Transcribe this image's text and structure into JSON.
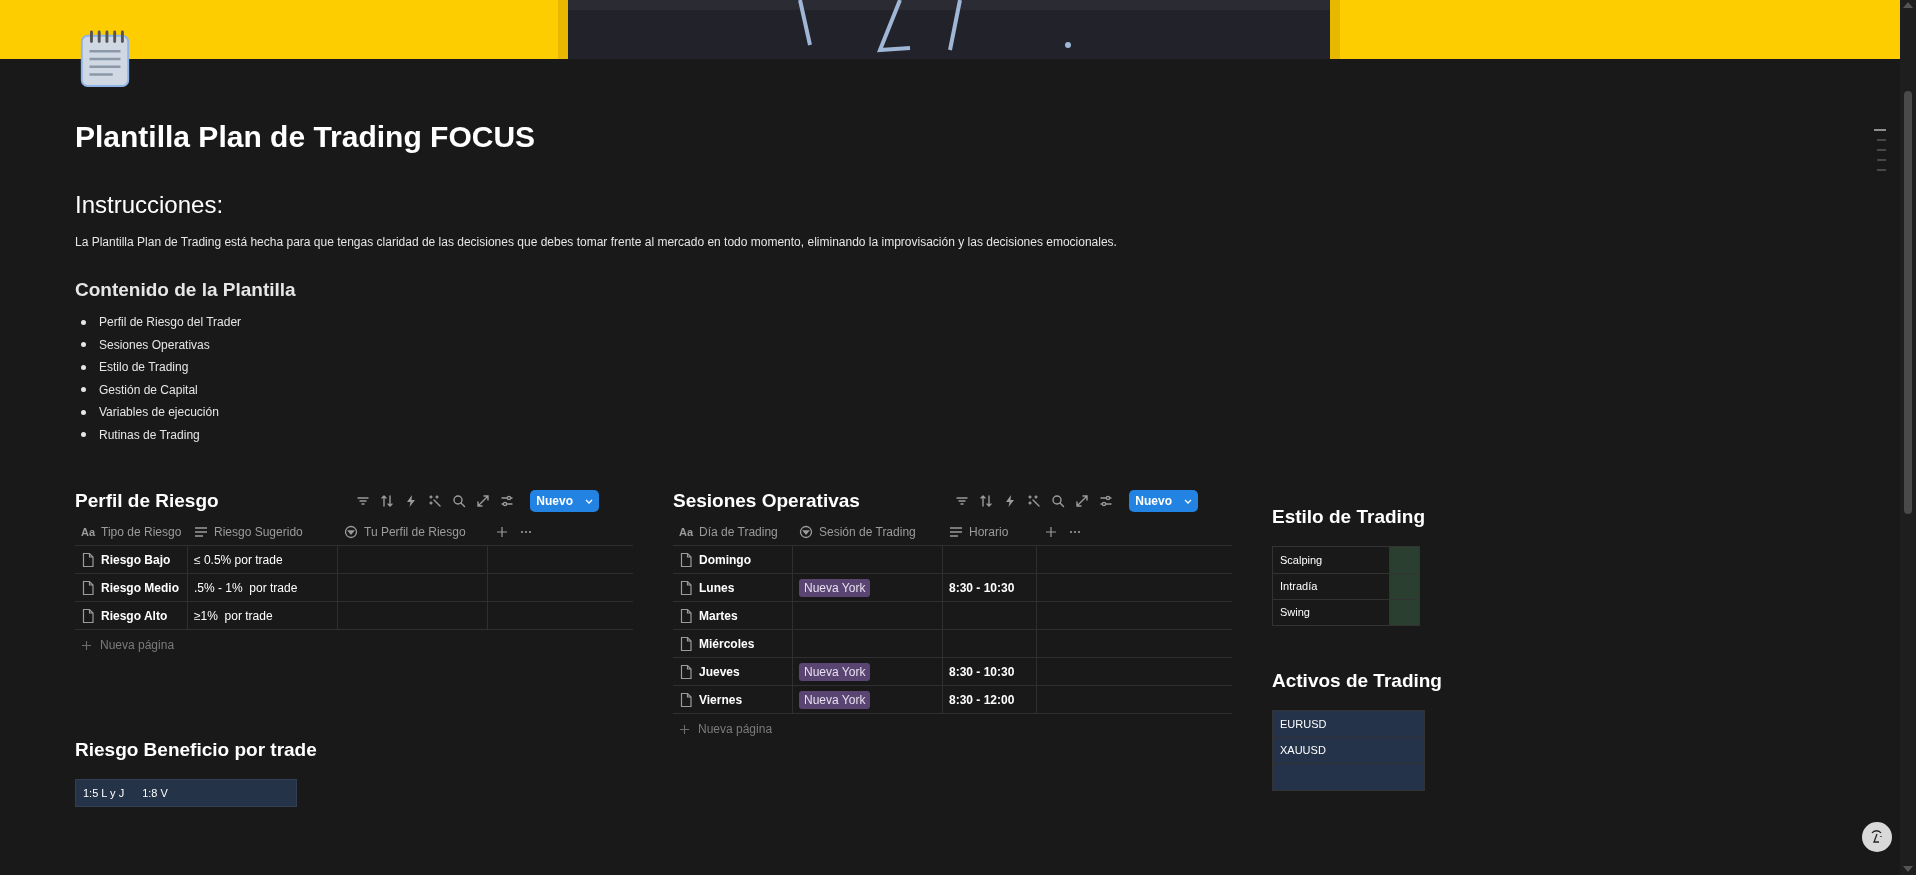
{
  "page": {
    "title": "Plantilla Plan de Trading FOCUS"
  },
  "instructions": {
    "heading": "Instrucciones:",
    "text": "La Plantilla Plan de Trading está hecha para que tengas claridad de las decisiones que debes tomar frente al mercado en todo momento, eliminando la improvisación y las decisiones emocionales."
  },
  "contents": {
    "heading": "Contenido de la Plantilla",
    "items": [
      "Perfil de Riesgo del Trader",
      "Sesiones Operativas",
      "Estilo de Trading",
      "Gestión de Capital",
      "Variables de ejecución",
      "Rutinas de Trading"
    ]
  },
  "perfil_de_riesgo": {
    "title": "Perfil de Riesgo",
    "new_button": "Nuevo",
    "add_row": "Nueva página",
    "columns": [
      {
        "label": "Tipo de Riesgo",
        "kind": "title",
        "glyph": "Aa"
      },
      {
        "label": "Riesgo Sugerido",
        "kind": "text"
      },
      {
        "label": "Tu Perfil de Riesgo",
        "kind": "select"
      }
    ],
    "rows": [
      {
        "name": "Riesgo Bajo",
        "values": [
          "≤ 0.5% por trade"
        ]
      },
      {
        "name": "Riesgo Medio",
        "values": [
          ".5% - 1%  por trade"
        ]
      },
      {
        "name": "Riesgo Alto",
        "values": [
          "≥1%  por trade"
        ]
      }
    ]
  },
  "sesiones_operativas": {
    "title": "Sesiones Operativas",
    "new_button": "Nuevo",
    "add_row": "Nueva página",
    "columns": [
      {
        "label": "Día de Trading",
        "kind": "title",
        "glyph": "Aa"
      },
      {
        "label": "Sesión de Trading",
        "kind": "select"
      },
      {
        "label": "Horario",
        "kind": "text"
      }
    ],
    "rows": [
      {
        "name": "Domingo"
      },
      {
        "name": "Lunes",
        "session": {
          "label": "Nueva York",
          "color": "#5a4472"
        },
        "schedule": "8:30 - 10:30"
      },
      {
        "name": "Martes"
      },
      {
        "name": "Miércoles"
      },
      {
        "name": "Jueves",
        "session": {
          "label": "Nueva York",
          "color": "#5a4472"
        },
        "schedule": "8:30 - 10:30"
      },
      {
        "name": "Viernes",
        "session": {
          "label": "Nueva York",
          "color": "#5a4472"
        },
        "schedule": "8:30 - 12:00"
      }
    ]
  },
  "estilo_de_trading": {
    "title": "Estilo de Trading",
    "items": [
      "Scalping",
      "Intradía",
      "Swing"
    ]
  },
  "activos_de_trading": {
    "title": "Activos de Trading",
    "items": [
      "EURUSD",
      "XAUUSD"
    ]
  },
  "riesgo_beneficio": {
    "title": "Riesgo Beneficio por trade",
    "values": [
      "1:5 L y J",
      "1:8 V"
    ]
  }
}
